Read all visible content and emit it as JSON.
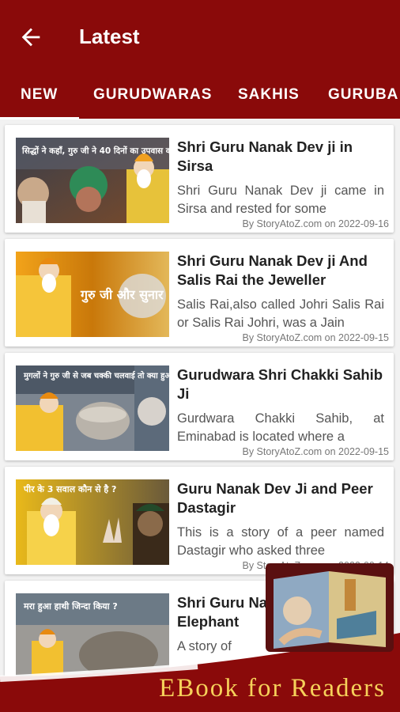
{
  "header": {
    "title": "Latest",
    "back_icon": "arrow-back-icon",
    "bg_color": "#8a0a0a"
  },
  "tabs": [
    {
      "label": "NEW",
      "active": true
    },
    {
      "label": "GURUDWARAS",
      "active": false
    },
    {
      "label": "SAKHIS",
      "active": false
    },
    {
      "label": "GURUBA",
      "active": false
    }
  ],
  "posts": [
    {
      "title": "Shri Guru Nanak Dev ji in Sirsa",
      "excerpt": "Shri Guru Nanak Dev ji came in Sirsa and rested for some",
      "meta": "By StoryAtoZ.com on 2022-09-16",
      "thumb_caption": "सिद्धों ने कहाँ, गुरु जी ने 40 दिनों का उपवास क्यों रखा ?"
    },
    {
      "title": "Shri Guru Nanak Dev ji And Salis Rai the Jeweller",
      "excerpt": "Salis Rai,also called Johri Salis Rai or Salis Rai Johri, was a Jain",
      "meta": "By StoryAtoZ.com on 2022-09-15",
      "thumb_caption": "गुरु जी और सुनार"
    },
    {
      "title": "Gurudwara Shri Chakki Sahib Ji",
      "excerpt": "Gurdwara Chakki Sahib, at Eminabad is located where a",
      "meta": "By StoryAtoZ.com on 2022-09-15",
      "thumb_caption": "मुगलों ने गुरु जी से जब चक्की चलवाई तो क्या हुआ ?"
    },
    {
      "title": "Guru Nanak Dev Ji and Peer Dastagir",
      "excerpt": "This is a story of a peer named Dastagir who asked three",
      "meta": "By StoryAtoZ.com on 2022-09-14",
      "thumb_caption": "पीर के 3 सवाल कौन से है ?"
    },
    {
      "title": "Shri Guru Nanak Dev Ji and Elephant",
      "excerpt": "A story of",
      "meta": "",
      "thumb_caption": "मरा हुआ हाथी जिन्दा किया ?"
    }
  ],
  "promo": {
    "text": "EBook for Readers",
    "text_color": "#f6d15a"
  }
}
